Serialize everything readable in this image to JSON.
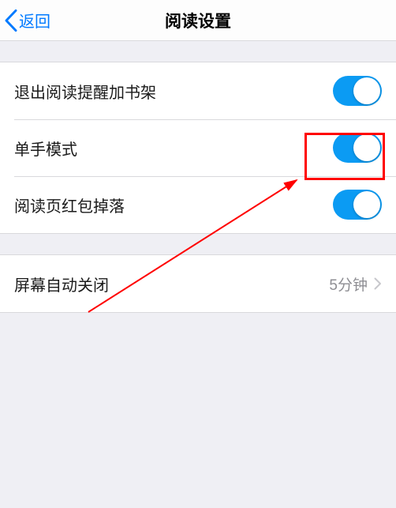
{
  "nav": {
    "back": "返回",
    "title": "阅读设置"
  },
  "rows": {
    "exit_reminder": {
      "label": "退出阅读提醒加书架",
      "on": true
    },
    "one_hand": {
      "label": "单手模式",
      "on": true
    },
    "hongbao": {
      "label": "阅读页红包掉落",
      "on": true
    },
    "auto_off": {
      "label": "屏幕自动关闭",
      "value": "5分钟"
    }
  }
}
